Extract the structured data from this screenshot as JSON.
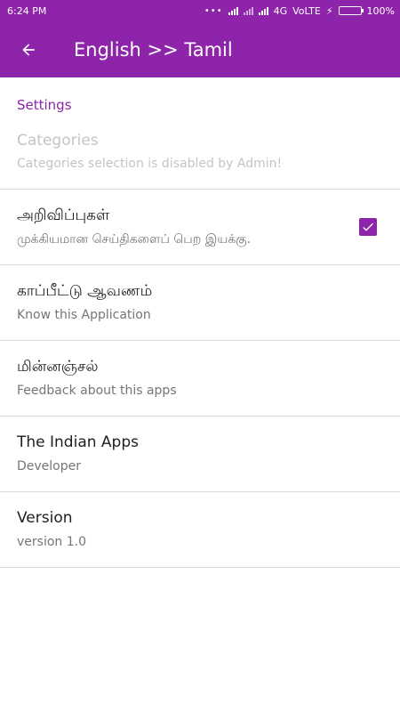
{
  "status_bar": {
    "time": "6:24 PM",
    "network": "4G",
    "volte": "VoLTE",
    "battery": "100%",
    "battery_level": 1.0
  },
  "toolbar": {
    "title": "English >> Tamil",
    "back_icon": "arrow-left-icon"
  },
  "settings": {
    "header": "Settings",
    "items": [
      {
        "title": "Categories",
        "summary": "Categories selection is disabled by Admin!",
        "enabled": false
      },
      {
        "title": "அறிவிப்புகள்",
        "summary": "முக்கியமான செய்திகளைப் பெற இயக்கு.",
        "checked": true
      },
      {
        "title": "காப்பீட்டு ஆவணம்",
        "summary": "Know this Application"
      },
      {
        "title": "மின்னஞ்சல்",
        "summary": "Feedback about this apps"
      },
      {
        "title": "The Indian Apps",
        "summary": "Developer"
      },
      {
        "title": "Version",
        "summary": "version 1.0"
      }
    ]
  },
  "colors": {
    "primary": "#8e24aa",
    "divider": "#d9d9d9",
    "disabled_text": "#c4c4c4"
  }
}
